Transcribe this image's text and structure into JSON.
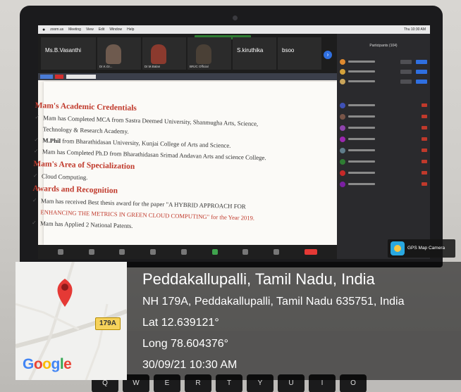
{
  "menubar": {
    "items": [
      "zoom.us",
      "Meeting",
      "View",
      "Edit",
      "Window",
      "Help"
    ],
    "clock": "Thu 10:30 AM"
  },
  "gallery": {
    "tiles": [
      {
        "name": "Ms.B.Vasanthi",
        "type": "text"
      },
      {
        "name": "Dr.K.Gr...",
        "type": "video"
      },
      {
        "name": "Dr.M.Balan",
        "type": "video"
      },
      {
        "name": "BRJC Official",
        "type": "video"
      },
      {
        "name": "S.kiruthika",
        "type": "text"
      },
      {
        "name": "bsoo",
        "type": "text"
      }
    ]
  },
  "slide": {
    "sections": [
      {
        "heading": "Mam's Academic Credentials",
        "items": [
          {
            "text": "Mam has Completed MCA from Sastra Deemed University, Shanmugha Arts, Science,"
          },
          {
            "text": "Technology & Research Academy.",
            "continuation": true
          },
          {
            "bold": "M.Phil",
            "text": " from Bharathidasan University, Kunjai College of Arts and Science."
          },
          {
            "text": "Mam has Completed  Ph.D from Bharathidasan Srimad Andavan Arts and science College."
          }
        ]
      },
      {
        "heading": "Mam's Area of Specialization",
        "items": [
          {
            "text": "Cloud Computing."
          }
        ]
      },
      {
        "heading": "Awards and Recognition",
        "items": [
          {
            "text": "Mam has received Best thesis award for the paper \"A HYBRID APPROACH FOR"
          },
          {
            "text": "ENHANCING THE METRICS IN GREEN CLOUD COMPUTING\" for the Year 2019.",
            "continuation": true,
            "caps": true
          },
          {
            "text": "Mam has Applied 2 National Patents."
          }
        ]
      }
    ]
  },
  "panel": {
    "title": "Participants (104)"
  },
  "badge": {
    "label": "GPS Map Camera"
  },
  "keyboard": {
    "keys": [
      "Q",
      "W",
      "E",
      "R",
      "T",
      "Y",
      "U",
      "I",
      "O"
    ]
  },
  "location": {
    "map_route_label": "179A",
    "google_label": [
      "G",
      "o",
      "o",
      "g",
      "l",
      "e"
    ],
    "title": "Peddakallupalli, Tamil Nadu, India",
    "address": "NH 179A, Peddakallupalli, Tamil Nadu 635751, India",
    "lat": "Lat 12.639121°",
    "long": "Long 78.604376°",
    "datetime": "30/09/21 10:30 AM"
  },
  "colors": {
    "heading_red": "#c0392b",
    "pin_red": "#e53935",
    "route_yellow": "#f6d25b"
  }
}
